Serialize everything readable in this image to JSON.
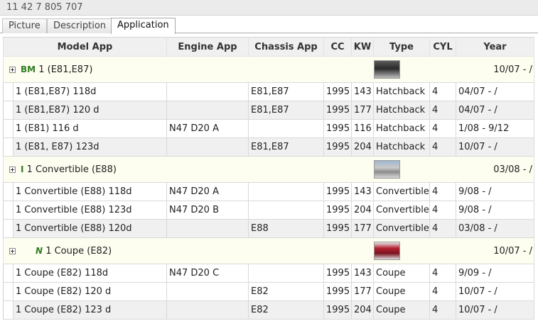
{
  "part_number": "11 42 7 805 707",
  "tabs": [
    {
      "label": "Picture"
    },
    {
      "label": "Description"
    },
    {
      "label": "Application",
      "active": true
    }
  ],
  "columns": {
    "model": "Model App",
    "engine": "Engine App",
    "chassis": "Chassis App",
    "cc": "CC",
    "kw": "KW",
    "type": "Type",
    "cyl": "CYL",
    "year": "Year"
  },
  "groups": [
    {
      "brand": "BM",
      "name": "1 (E81,E87)",
      "year": "10/07 - /",
      "rows": [
        {
          "model": "1 (E81,E87) 118d",
          "engine": "",
          "chassis": "E81,E87",
          "cc": "1995",
          "kw": "143",
          "type": "Hatchback",
          "cyl": "4",
          "year": "04/07 - /"
        },
        {
          "model": "1 (E81,E87) 120 d",
          "engine": "",
          "chassis": "E81,E87",
          "cc": "1995",
          "kw": "177",
          "type": "Hatchback",
          "cyl": "4",
          "year": "04/07 - /"
        },
        {
          "model": "1 (E81) 116 d",
          "engine": "N47 D20 A",
          "chassis": "",
          "cc": "1995",
          "kw": "116",
          "type": "Hatchback",
          "cyl": "4",
          "year": "1/08 - 9/12"
        },
        {
          "model": "1 (E81, E87) 123d",
          "engine": "",
          "chassis": "E81,E87",
          "cc": "1995",
          "kw": "204",
          "type": "Hatchback",
          "cyl": "4",
          "year": "10/07 - /"
        }
      ]
    },
    {
      "brand": "I",
      "name": "1 Convertible (E88)",
      "year": "03/08 - /",
      "rows": [
        {
          "model": "1 Convertible (E88) 118d",
          "engine": "N47 D20 A",
          "chassis": "",
          "cc": "1995",
          "kw": "143",
          "type": "Convertible",
          "cyl": "4",
          "year": "9/08 - /"
        },
        {
          "model": "1 Convertible (E88) 123d",
          "engine": "N47 D20 B",
          "chassis": "",
          "cc": "1995",
          "kw": "204",
          "type": "Convertible",
          "cyl": "4",
          "year": "9/08 - /"
        },
        {
          "model": "1 Convertible (E88) 120d",
          "engine": "",
          "chassis": "E88",
          "cc": "1995",
          "kw": "177",
          "type": "Convertible",
          "cyl": "4",
          "year": "03/08 - /"
        }
      ]
    },
    {
      "brand": "N",
      "name": "1 Coupe (E82)",
      "year": "10/07 - /",
      "rows": [
        {
          "model": "1 Coupe (E82) 118d",
          "engine": "N47 D20 C",
          "chassis": "",
          "cc": "1995",
          "kw": "143",
          "type": "Coupe",
          "cyl": "4",
          "year": "9/09 - /"
        },
        {
          "model": "1 Coupe (E82) 120 d",
          "engine": "",
          "chassis": "E82",
          "cc": "1995",
          "kw": "177",
          "type": "Coupe",
          "cyl": "4",
          "year": "10/07 - /"
        },
        {
          "model": "1 Coupe (E82) 123 d",
          "engine": "",
          "chassis": "E82",
          "cc": "1995",
          "kw": "204",
          "type": "Coupe",
          "cyl": "4",
          "year": "10/07 - /"
        }
      ]
    }
  ],
  "icons": {
    "expand": "plus-box-icon",
    "thumbnail": "car-thumbnail"
  },
  "colors": {
    "brand_green": "#2e7d1e",
    "group_row_bg": "#fdfdf0",
    "alt_row_bg": "#f0f0f0"
  }
}
